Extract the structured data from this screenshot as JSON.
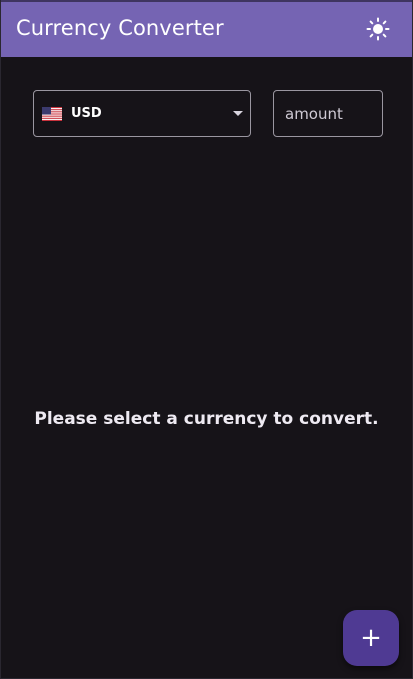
{
  "app": {
    "title": "Currency Converter",
    "icons": {
      "theme_toggle": "sun-icon",
      "add": "plus-icon",
      "flag": "us-flag-icon"
    },
    "colors": {
      "appbar": "#7564b3",
      "background": "#161318",
      "fab": "#4f3a93",
      "text": "#ffffff"
    }
  },
  "converter": {
    "currency": {
      "selected": "USD"
    },
    "amount": {
      "value": "",
      "placeholder": "amount"
    }
  },
  "empty_state": {
    "message": "Please select a currency to convert."
  },
  "fab": {
    "label": "+"
  }
}
